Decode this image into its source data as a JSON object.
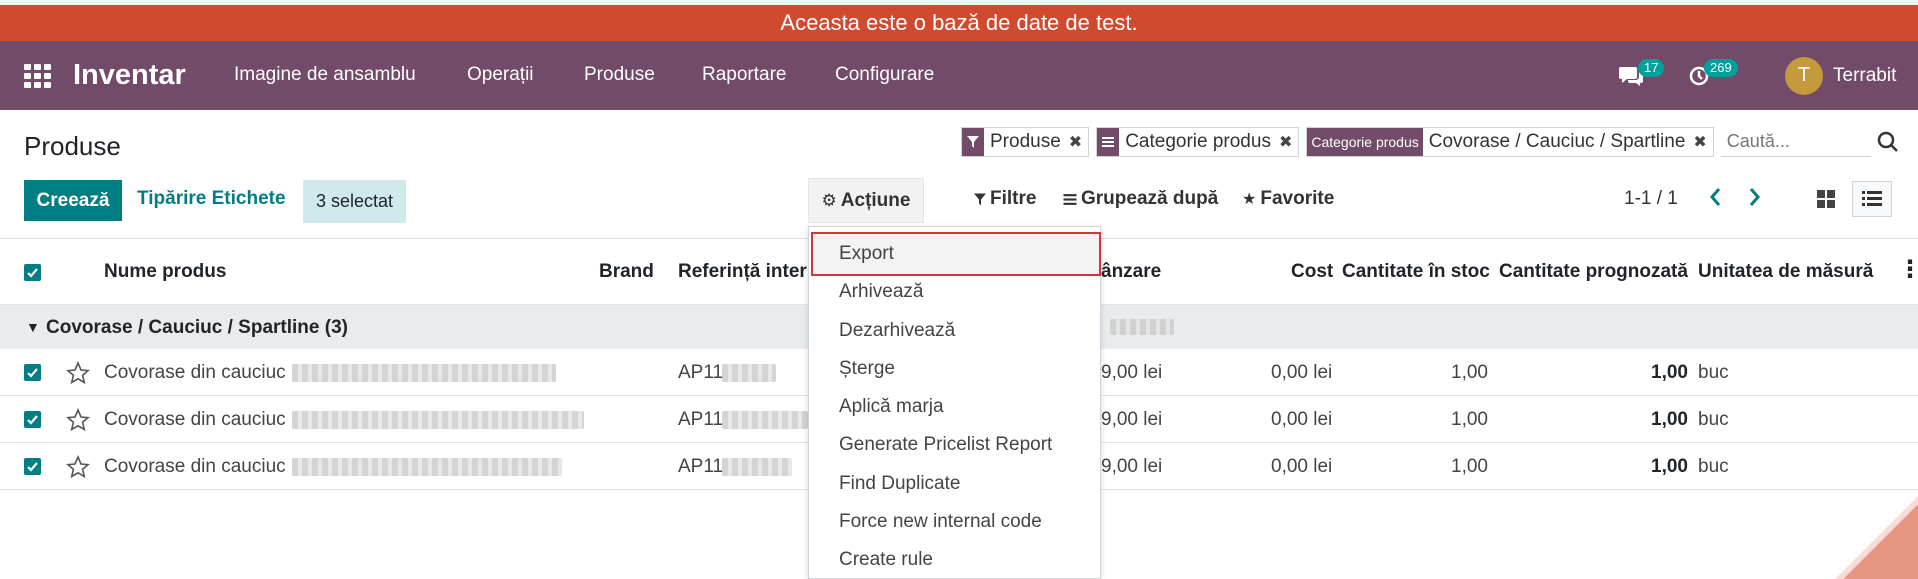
{
  "banner": {
    "text": "Aceasta este o bază de date de test."
  },
  "navbar": {
    "app_name": "Inventar",
    "menus": [
      "Imagine de ansamblu",
      "Operații",
      "Produse",
      "Raportare",
      "Configurare"
    ],
    "messages_count": "17",
    "activities_count": "269",
    "user_initial": "T",
    "user_name": "Terrabit"
  },
  "page": {
    "title": "Produse",
    "create_label": "Creează",
    "print_labels": "Tipărire Etichete",
    "selected_text": "3 selectat",
    "actions_label": "Acțiune",
    "filters_label": "Filtre",
    "groupby_label": "Grupează după",
    "favorites_label": "Favorite",
    "pager": "1-1 / 1"
  },
  "search": {
    "facets": [
      {
        "label": "",
        "value": "Produse"
      },
      {
        "label": "",
        "value": "Categorie produs"
      },
      {
        "label": "Categorie produs",
        "value": "Covorase / Cauciuc / Spartline"
      }
    ],
    "placeholder": "Caută..."
  },
  "table": {
    "columns": {
      "name": "Nume produs",
      "brand": "Brand",
      "ref": "Referință intern",
      "sale": "ânzare",
      "cost": "Cost",
      "qty_stock": "Cantitate în stoc",
      "qty_forecast": "Cantitate prognozată",
      "uom": "Unitatea de măsură"
    },
    "group": {
      "label": "Covorase / Cauciuc / Spartline (3)"
    },
    "rows": [
      {
        "name": "Covorase din cauciuc",
        "ref": "AP11",
        "sale": "9,00 lei",
        "cost": "0,00 lei",
        "qty_stock": "1,00",
        "qty_forecast": "1,00",
        "uom": "buc"
      },
      {
        "name": "Covorase din cauciuc",
        "ref": "AP11",
        "sale": "9,00 lei",
        "cost": "0,00 lei",
        "qty_stock": "1,00",
        "qty_forecast": "1,00",
        "uom": "buc"
      },
      {
        "name": "Covorase din cauciuc",
        "ref": "AP11",
        "sale": "9,00 lei",
        "cost": "0,00 lei",
        "qty_stock": "1,00",
        "qty_forecast": "1,00",
        "uom": "buc"
      }
    ]
  },
  "actions_menu": {
    "items": [
      "Export",
      "Arhivează",
      "Dezarhivează",
      "Șterge",
      "Aplică marja",
      "Generate Pricelist Report",
      "Find Duplicate",
      "Force new internal code",
      "Create rule"
    ]
  },
  "colors": {
    "primary": "#714b67",
    "accent": "#017e84",
    "banner": "#d04a2f",
    "highlight": "#d0363c"
  }
}
